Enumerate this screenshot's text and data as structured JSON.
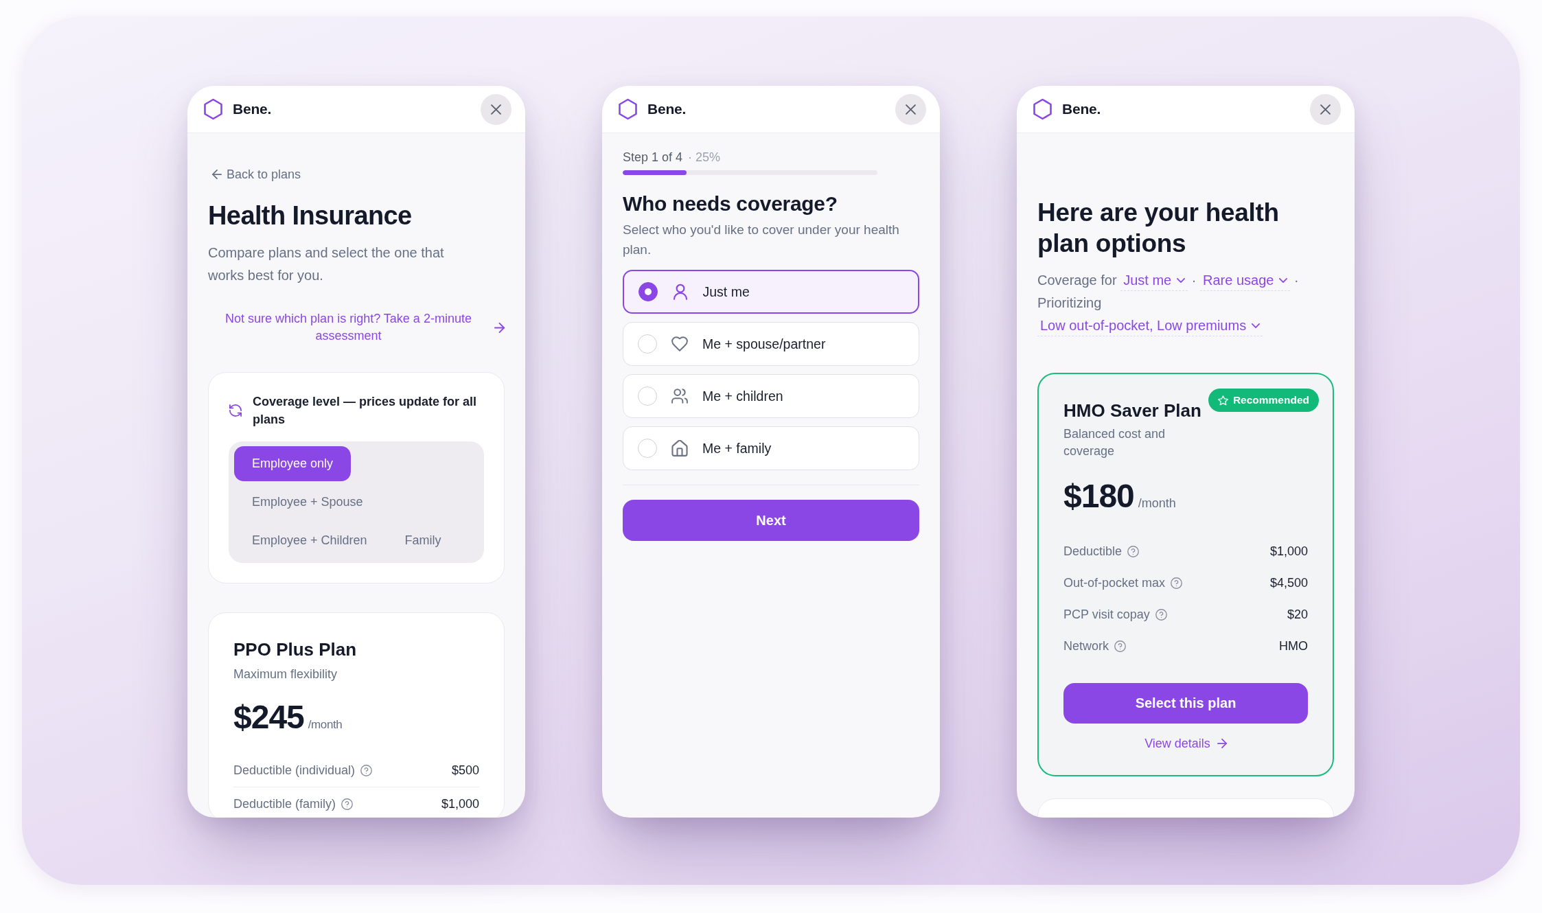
{
  "panels": [
    {
      "kind": "plans",
      "brand": "Bene.",
      "back_link": "Back to plans",
      "title": "Health Insurance",
      "subtitle": "Compare plans and select the one that works best for you.",
      "assessment_link": "Not sure which plan is right? Take a 2-minute assessment",
      "coverage_level": {
        "label": "Coverage level — prices update for all plans",
        "options": [
          {
            "label": "Employee only",
            "selected": true
          },
          {
            "label": "Employee + Spouse",
            "selected": false
          },
          {
            "label": "Employee + Children",
            "selected": false
          },
          {
            "label": "Family",
            "selected": false
          }
        ]
      },
      "plans": [
        {
          "name": "PPO Plus Plan",
          "tagline": "Maximum flexibility",
          "price": "$245",
          "period": "/month",
          "details": [
            {
              "label": "Deductible (individual)",
              "value": "$500"
            },
            {
              "label": "Deductible (family)",
              "value": "$1,000"
            }
          ]
        }
      ]
    },
    {
      "kind": "question",
      "brand": "Bene.",
      "progress": {
        "step": "Step 1 of 4",
        "percent": "· 25%",
        "level": 0.25
      },
      "title": "Who needs coverage?",
      "subtitle": "Select who you'd like to cover under your health plan.",
      "options": [
        {
          "label": "Just me",
          "selected": true
        },
        {
          "label": "Me + spouse/partner",
          "selected": false
        },
        {
          "label": "Me + children",
          "selected": false
        },
        {
          "label": "Me + family",
          "selected": false
        }
      ],
      "next_button": "Next"
    },
    {
      "kind": "results",
      "brand": "Bene.",
      "title": "Here are your health plan options",
      "summary": [
        {
          "kind": "text",
          "text": "Coverage for"
        },
        {
          "kind": "choice",
          "text": "Just me"
        },
        {
          "kind": "text",
          "text": "·"
        },
        {
          "kind": "choice",
          "text": "Rare usage"
        },
        {
          "kind": "text",
          "text": "·"
        },
        {
          "kind": "text",
          "text": "Prioritizing"
        },
        {
          "kind": "choice",
          "text": "Low out-of-pocket, Low premiums"
        }
      ],
      "plans": [
        {
          "name": "HMO Saver Plan",
          "tagline": "Balanced cost and coverage",
          "badge": "Recommended",
          "price": "$180",
          "period": "/month",
          "details": [
            {
              "label": "Deductible",
              "value": "$1,000"
            },
            {
              "label": "Out-of-pocket max",
              "value": "$4,500"
            },
            {
              "label": "PCP visit copay",
              "value": "$20"
            },
            {
              "label": "Network",
              "value": "HMO"
            }
          ],
          "select_button": "Select this plan",
          "details_link": "View details"
        }
      ]
    }
  ]
}
